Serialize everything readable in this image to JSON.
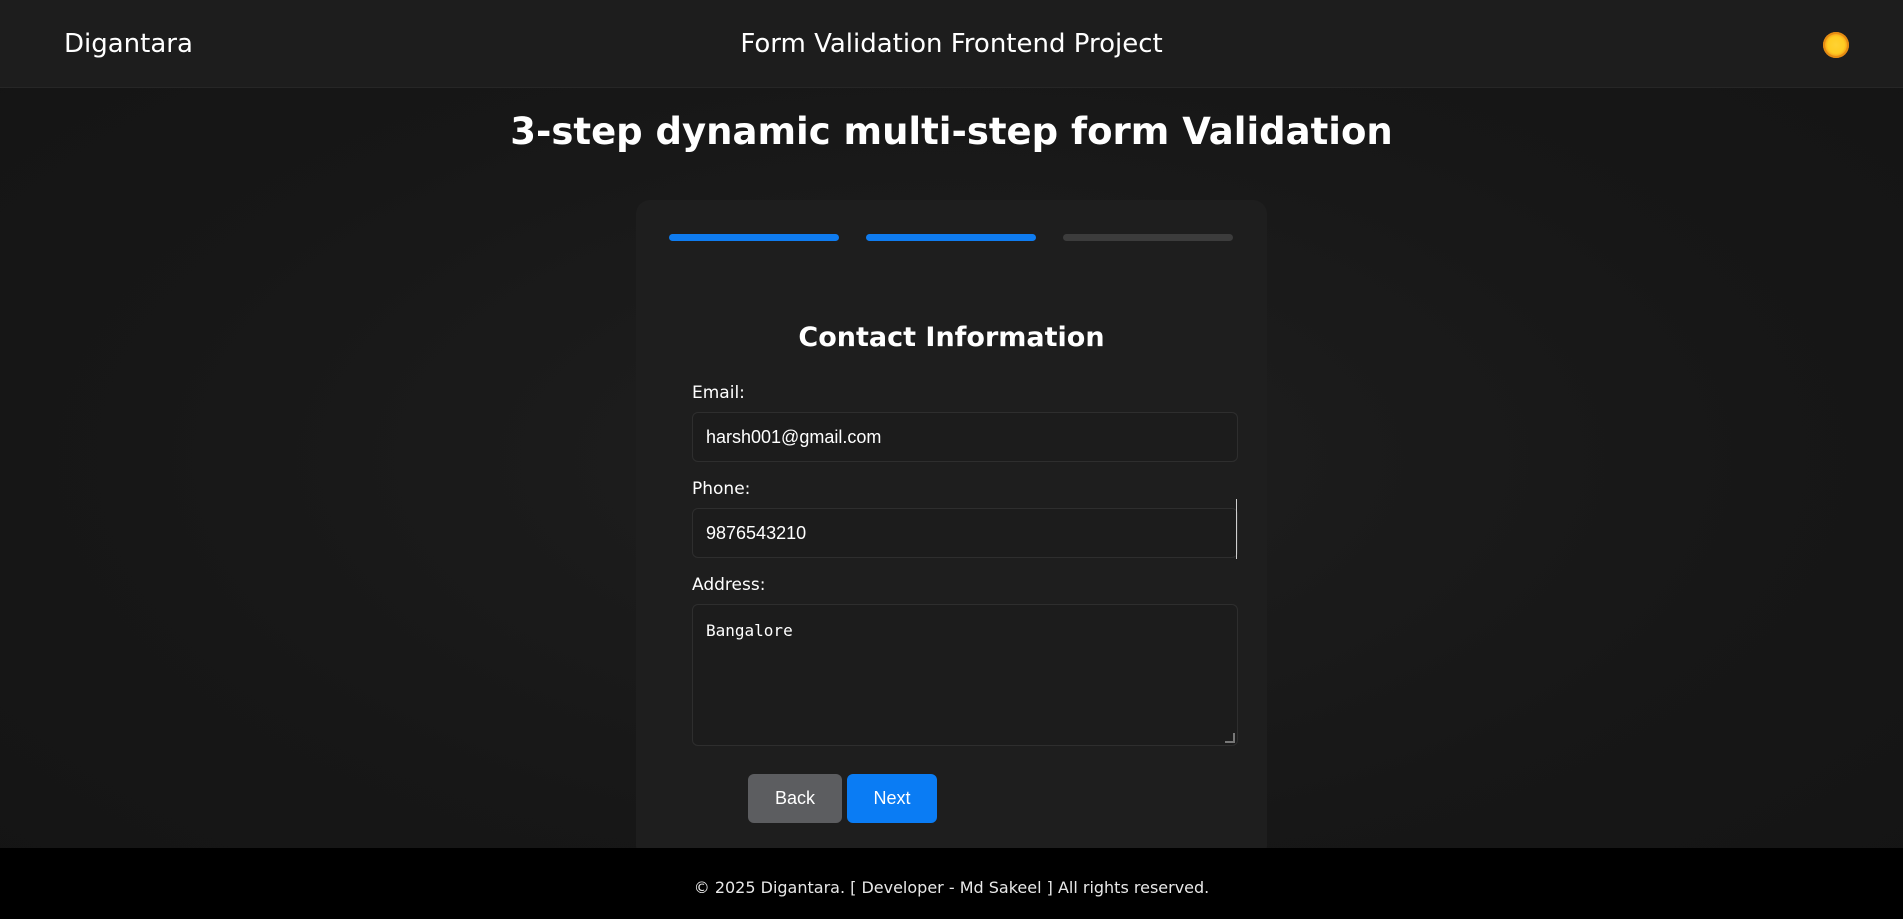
{
  "header": {
    "brand": "Digantara",
    "title": "Form Validation Frontend Project",
    "theme_icon": "sun-icon"
  },
  "page": {
    "title": "3-step dynamic multi-step form Validation"
  },
  "form": {
    "steps": [
      {
        "state": "complete"
      },
      {
        "state": "current"
      },
      {
        "state": "pending"
      }
    ],
    "section_title": "Contact Information",
    "fields": {
      "email": {
        "label": "Email:",
        "value": "harsh001@gmail.com"
      },
      "phone": {
        "label": "Phone:",
        "value": "9876543210"
      },
      "address": {
        "label": "Address:",
        "value": "Bangalore"
      }
    },
    "buttons": {
      "back": "Back",
      "next": "Next"
    },
    "colors": {
      "accent": "#0a7cf4",
      "secondary_button": "#5c5d60",
      "inactive_step": "#3c3c3c"
    }
  },
  "footer": {
    "text": "© 2025 Digantara. [ Developer - Md Sakeel ] All rights reserved."
  }
}
